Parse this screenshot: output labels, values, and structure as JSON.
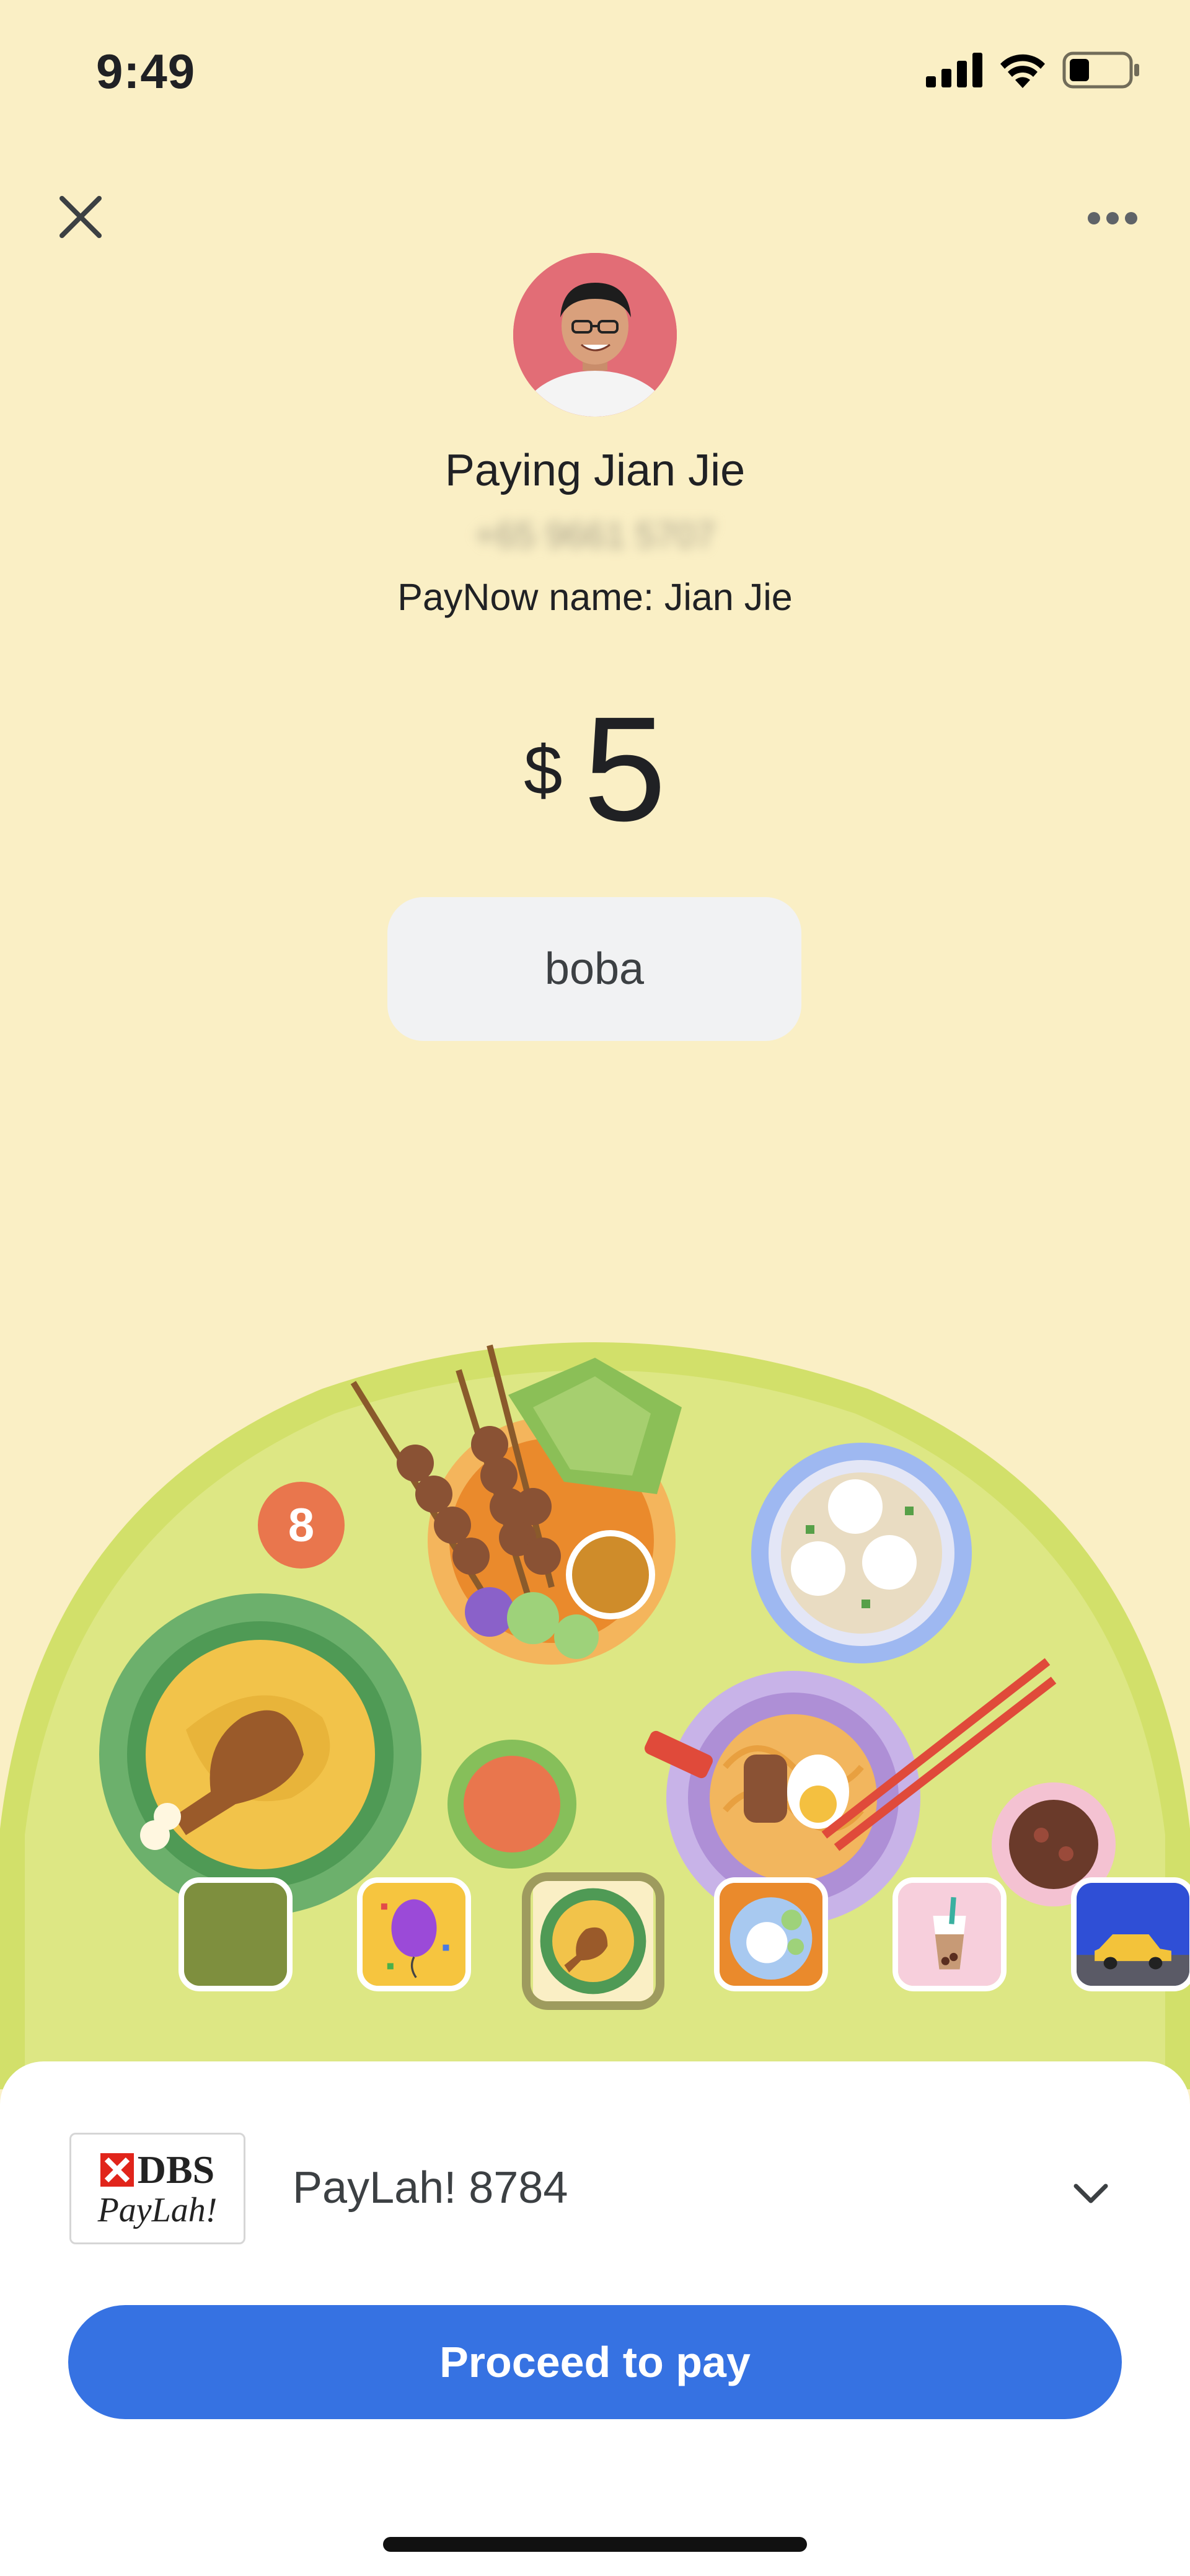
{
  "status_bar": {
    "time": "9:49",
    "icons": [
      "signal-icon",
      "wifi-icon",
      "battery-icon"
    ],
    "battery_level": 0.35
  },
  "top_bar": {
    "close_icon": "close-icon",
    "more_icon": "more-options-icon"
  },
  "payee": {
    "title": "Paying Jian Jie",
    "phone": "+65 9661 5707",
    "paynow_name": "PayNow name: Jian Jie",
    "avatar_bg": "#e26d76"
  },
  "payment": {
    "currency_symbol": "$",
    "amount": "5",
    "note": "boba"
  },
  "illustration": {
    "badge_count": "8",
    "themes": [
      {
        "name": "green-theme",
        "selected": false
      },
      {
        "name": "balloon-theme",
        "selected": false
      },
      {
        "name": "food-theme",
        "selected": true
      },
      {
        "name": "rice-theme",
        "selected": false
      },
      {
        "name": "bubble-tea-theme",
        "selected": false
      },
      {
        "name": "taxi-theme",
        "selected": false
      }
    ]
  },
  "payment_method": {
    "logo_line1": "DBS",
    "logo_line2": "PayLah!",
    "account_label": "PayLah! 8784",
    "dropdown_icon": "chevron-down-icon"
  },
  "actions": {
    "proceed_label": "Proceed to pay"
  },
  "colors": {
    "background": "#faefc5",
    "primary_button": "#3672e2",
    "badge": "#e9764d",
    "table_green": "#d8e57a"
  }
}
